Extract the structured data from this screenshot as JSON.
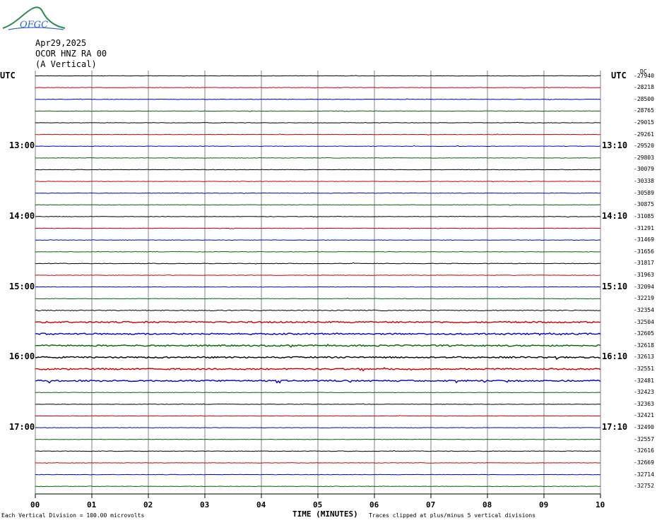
{
  "logo": {
    "text": "OFGC",
    "icon": "observatory-mountain-logo"
  },
  "header": {
    "date": "Apr29,2025",
    "station": "OCOR HNZ RA 00",
    "component": "(A Vertical)"
  },
  "utc_left": "UTC",
  "utc_right": "UTC",
  "dc_label": "DC",
  "footer": {
    "scale_note": "Each Vertical Division =  100.00 microvolts",
    "time_axis": "TIME (MINUTES)",
    "clip_note": "Traces clipped at plus/minus 5 vertical divisions"
  },
  "colors": {
    "trace_cycle": [
      "#000000",
      "#cc0000",
      "#0000cc",
      "#006600"
    ],
    "grid": "#808080"
  },
  "chart_data": {
    "type": "line",
    "xlabel": "TIME (MINUTES)",
    "x_ticks": [
      "00",
      "01",
      "02",
      "03",
      "04",
      "05",
      "06",
      "07",
      "08",
      "09",
      "10"
    ],
    "xlim": [
      0,
      10
    ],
    "left_time_labels": [
      {
        "trace": 6,
        "label": "13:00"
      },
      {
        "trace": 12,
        "label": "14:00"
      },
      {
        "trace": 18,
        "label": "15:00"
      },
      {
        "trace": 24,
        "label": "16:00"
      },
      {
        "trace": 30,
        "label": "17:00"
      }
    ],
    "right_time_labels": [
      {
        "trace": 6,
        "label": "13:10"
      },
      {
        "trace": 12,
        "label": "14:10"
      },
      {
        "trace": 18,
        "label": "15:10"
      },
      {
        "trace": 24,
        "label": "16:10"
      },
      {
        "trace": 30,
        "label": "17:10"
      }
    ],
    "dc_offsets": [
      "-27940",
      "-28218",
      "-28500",
      "-28765",
      "-29015",
      "-29261",
      "-29520",
      "-29803",
      "-30079",
      "-30338",
      "-30589",
      "-30875",
      "-31085",
      "-31291",
      "-31469",
      "-31656",
      "-31817",
      "-31963",
      "-32094",
      "-32219",
      "-32354",
      "-32504",
      "-32605",
      "-32618",
      "-32613",
      "-32551",
      "-32481",
      "-32423",
      "-32363",
      "-32421",
      "-32490",
      "-32557",
      "-32616",
      "-32669",
      "-32714",
      "-32752"
    ],
    "trace_noise_level": [
      0.3,
      0.3,
      0.3,
      0.3,
      0.3,
      0.3,
      0.3,
      0.3,
      0.3,
      0.3,
      0.3,
      0.3,
      0.3,
      0.3,
      0.3,
      0.3,
      0.4,
      0.3,
      0.3,
      0.3,
      0.6,
      1,
      1,
      1,
      1,
      1,
      1,
      0.3,
      0.3,
      0.3,
      0.3,
      0.3,
      0.4,
      0.3,
      0.3,
      0.3
    ]
  }
}
